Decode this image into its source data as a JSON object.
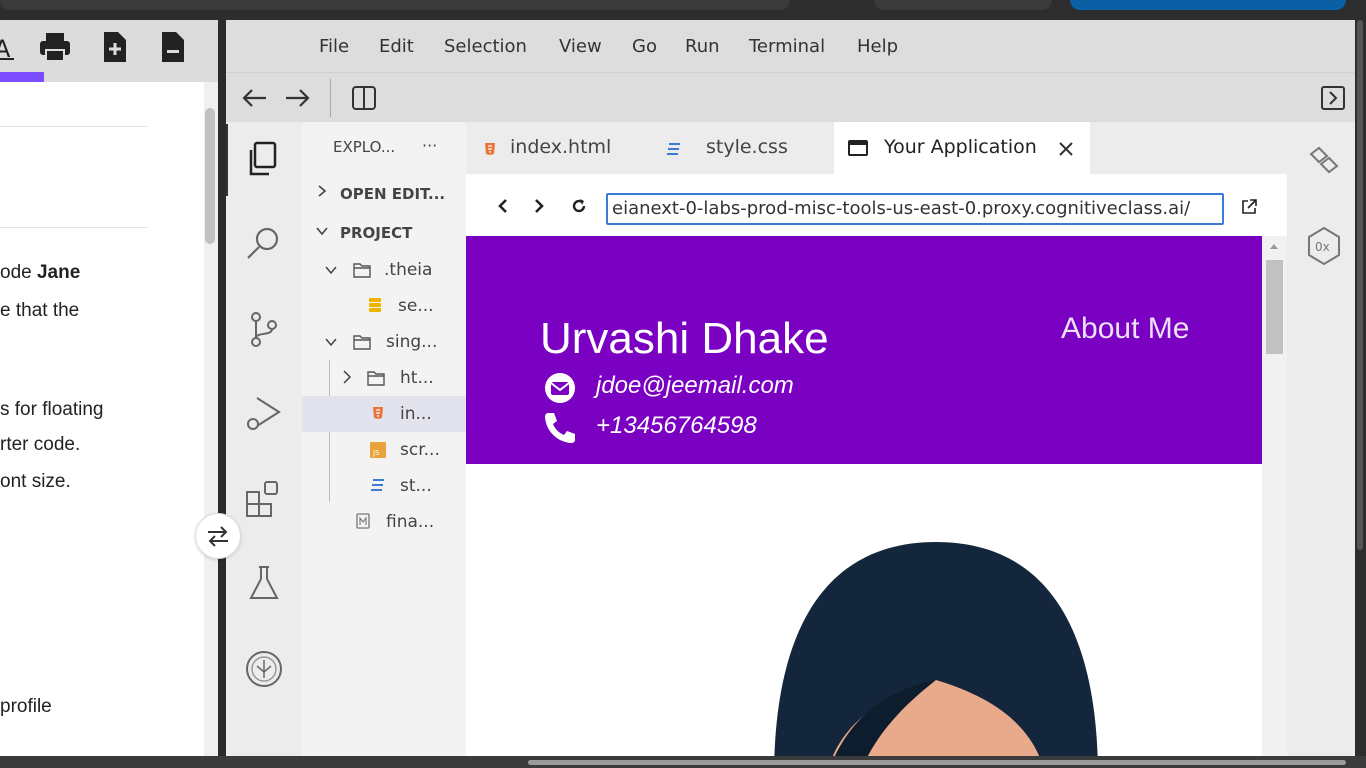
{
  "colors": {
    "hero_bg": "#7a00c2",
    "accent": "#7c4dff",
    "url_border": "#3a7bd5"
  },
  "left_pane": {
    "lines": [
      {
        "pre": "ode ",
        "bold": "Jane"
      },
      {
        "pre": "e that the",
        "bold": ""
      },
      {
        "pre": "s for floating",
        "bold": ""
      },
      {
        "pre": "rter code.",
        "bold": ""
      },
      {
        "pre": "ont size.",
        "bold": ""
      },
      {
        "pre": " profile",
        "bold": ""
      }
    ]
  },
  "menu": {
    "items": [
      "File",
      "Edit",
      "Selection",
      "View",
      "Go",
      "Run",
      "Terminal",
      "Help"
    ]
  },
  "explorer": {
    "title": "EXPLO...",
    "more": "···",
    "open_editors": "OPEN EDIT...",
    "project": "PROJECT",
    "tree": [
      ".theia",
      "se...",
      "sing...",
      "ht...",
      "in...",
      "scr...",
      "st...",
      "fina..."
    ]
  },
  "tabs": [
    {
      "label": "index.html",
      "icon": "html-file-icon"
    },
    {
      "label": "style.css",
      "icon": "css-file-icon"
    },
    {
      "label": "Your Application",
      "icon": "browser-window-icon",
      "active": true
    }
  ],
  "browser": {
    "url": "eianext-0-labs-prod-misc-tools-us-east-0.proxy.cognitiveclass.ai/"
  },
  "app": {
    "name": "Urvashi Dhake",
    "nav_about": "About Me",
    "email": "jdoe@jeemail.com",
    "phone": "+13456764598"
  }
}
